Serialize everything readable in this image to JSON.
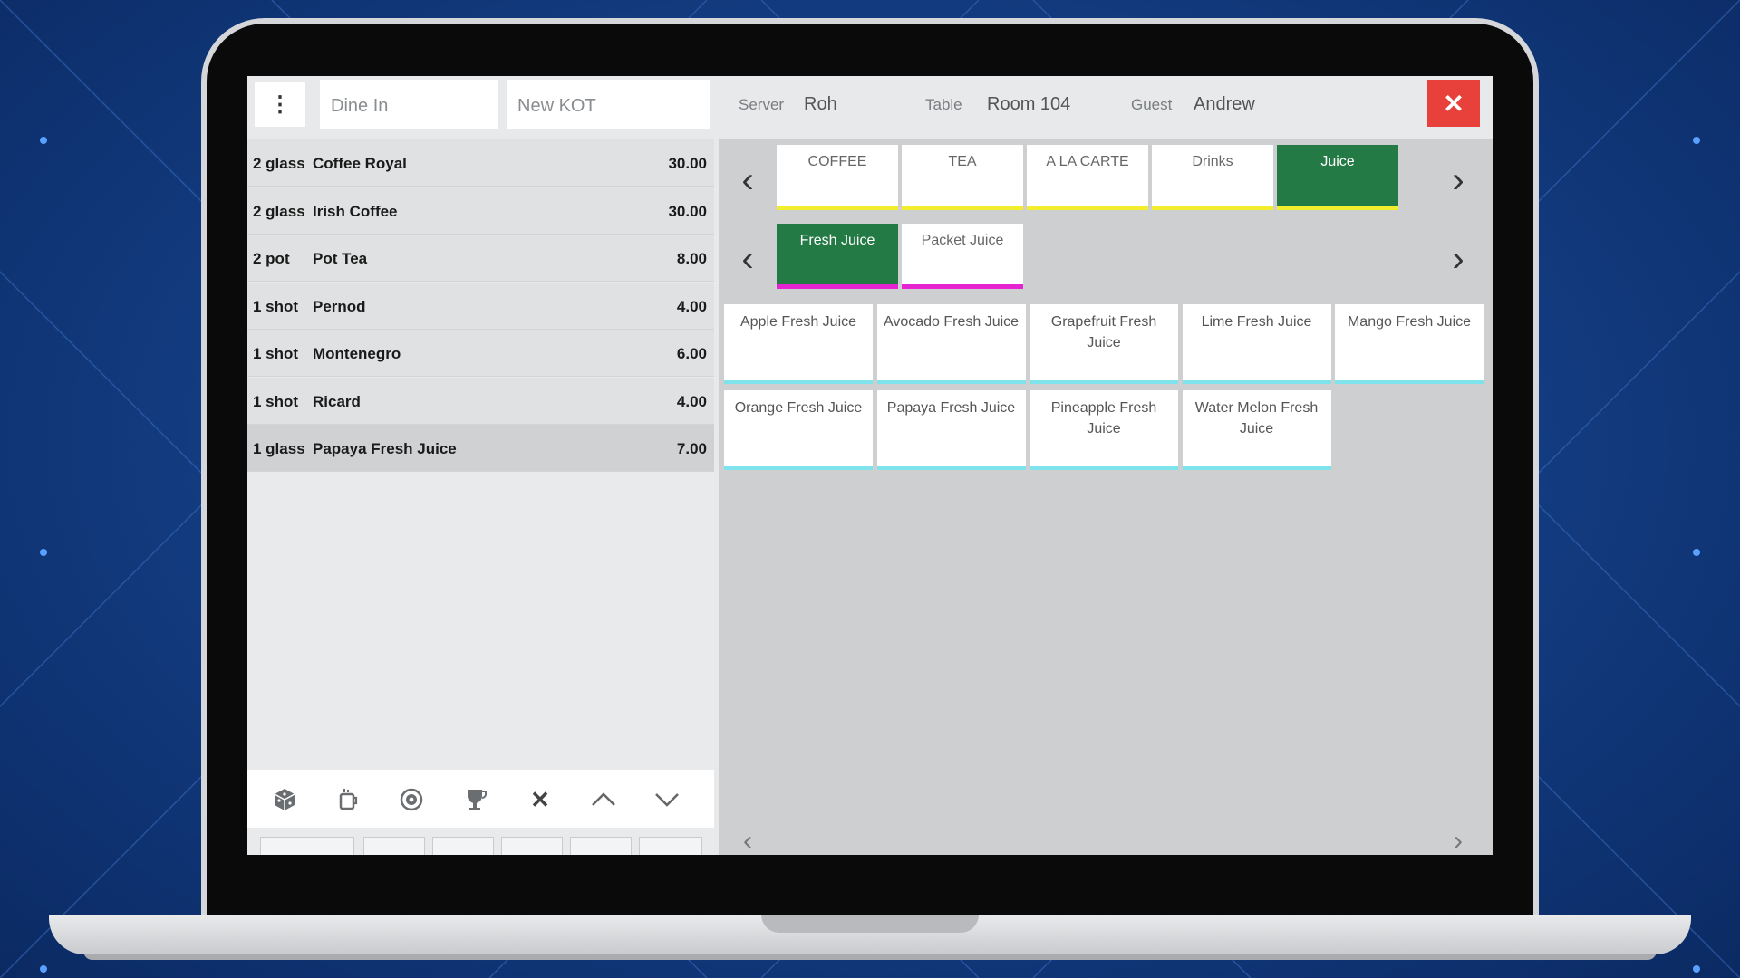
{
  "topbar": {
    "order_type": "Dine In",
    "kot": "New KOT",
    "server_label": "Server",
    "server_value": "Roh",
    "table_label": "Table",
    "table_value": "Room 104",
    "guest_label": "Guest",
    "guest_value": "Andrew",
    "close_label": "✕"
  },
  "order_items": [
    {
      "qty": "2 glass",
      "name": "Coffee Royal",
      "price": "30.00"
    },
    {
      "qty": "2 glass",
      "name": "Irish Coffee",
      "price": "30.00"
    },
    {
      "qty": "2 pot",
      "name": "Pot Tea",
      "price": "8.00"
    },
    {
      "qty": "1 shot",
      "name": "Pernod",
      "price": "4.00"
    },
    {
      "qty": "1 shot",
      "name": "Montenegro",
      "price": "6.00"
    },
    {
      "qty": "1 shot",
      "name": "Ricard",
      "price": "4.00"
    },
    {
      "qty": "1 glass",
      "name": "Papaya Fresh Juice",
      "price": "7.00",
      "selected": true
    }
  ],
  "toolbar_icons": [
    "dice-icon",
    "cup-icon",
    "coin-icon",
    "trophy-icon",
    "delete-icon",
    "chevron-up-icon",
    "chevron-down-icon"
  ],
  "categories": [
    {
      "label": "COFFEE",
      "bar_color": "#f2ee2e"
    },
    {
      "label": "TEA",
      "bar_color": "#f2ee2e"
    },
    {
      "label": "A LA CARTE",
      "bar_color": "#f2ee2e"
    },
    {
      "label": "Drinks",
      "bar_color": "#f2ee2e"
    },
    {
      "label": "Juice",
      "bar_color": "#f2ee2e",
      "active": true
    }
  ],
  "subcategories": [
    {
      "label": "Fresh Juice",
      "bar_color": "#e623d0",
      "active": true
    },
    {
      "label": "Packet Juice",
      "bar_color": "#e623d0"
    }
  ],
  "items": [
    "Apple Fresh Juice",
    "Avocado Fresh Juice",
    "Grapefruit Fresh Juice",
    "Lime Fresh Juice",
    "Mango Fresh Juice",
    "Orange Fresh Juice",
    "Papaya Fresh Juice",
    "Pineapple Fresh Juice",
    "Water Melon Fresh Juice"
  ],
  "colors": {
    "accent_green": "#247a44",
    "close_red": "#e8413b",
    "item_bar": "#7fe3ec"
  }
}
